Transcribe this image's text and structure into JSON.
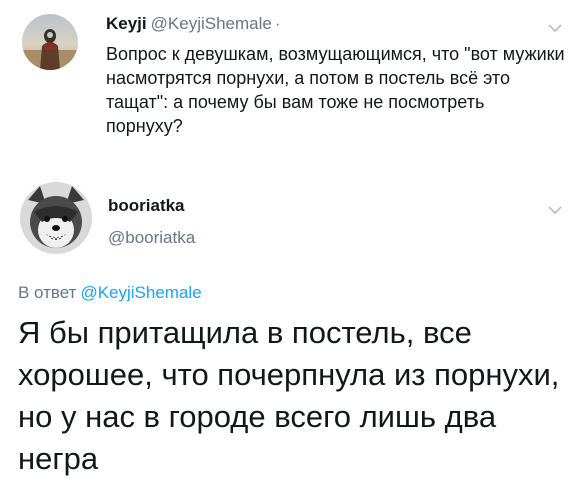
{
  "original_tweet": {
    "display_name": "Keyji",
    "handle": "@KeyjiShemale",
    "separator": "·",
    "text": "Вопрос к девушкам, возмущающимся, что \"вот мужики насмотрятся порнухи, а потом в постель всё это тащат\": а почему бы вам тоже не посмотреть порнуху?",
    "menu_icon": "chevron-down-icon",
    "avatar_icon": "profile-photo-desert-figure"
  },
  "reply_tweet": {
    "display_name": "booriatka",
    "handle": "@booriatka",
    "menu_icon": "chevron-down-icon",
    "avatar_icon": "profile-photo-husky-dog",
    "reply_context_prefix": "В ответ",
    "reply_context_mention": "@KeyjiShemale",
    "text": "Я бы притащила в постель, все хорошее, что почерпнула из порнухи, но у нас в городе всего лишь два негра"
  },
  "colors": {
    "text_primary": "#14171a",
    "text_secondary": "#657786",
    "link": "#1da1f2",
    "background": "#ffffff"
  }
}
